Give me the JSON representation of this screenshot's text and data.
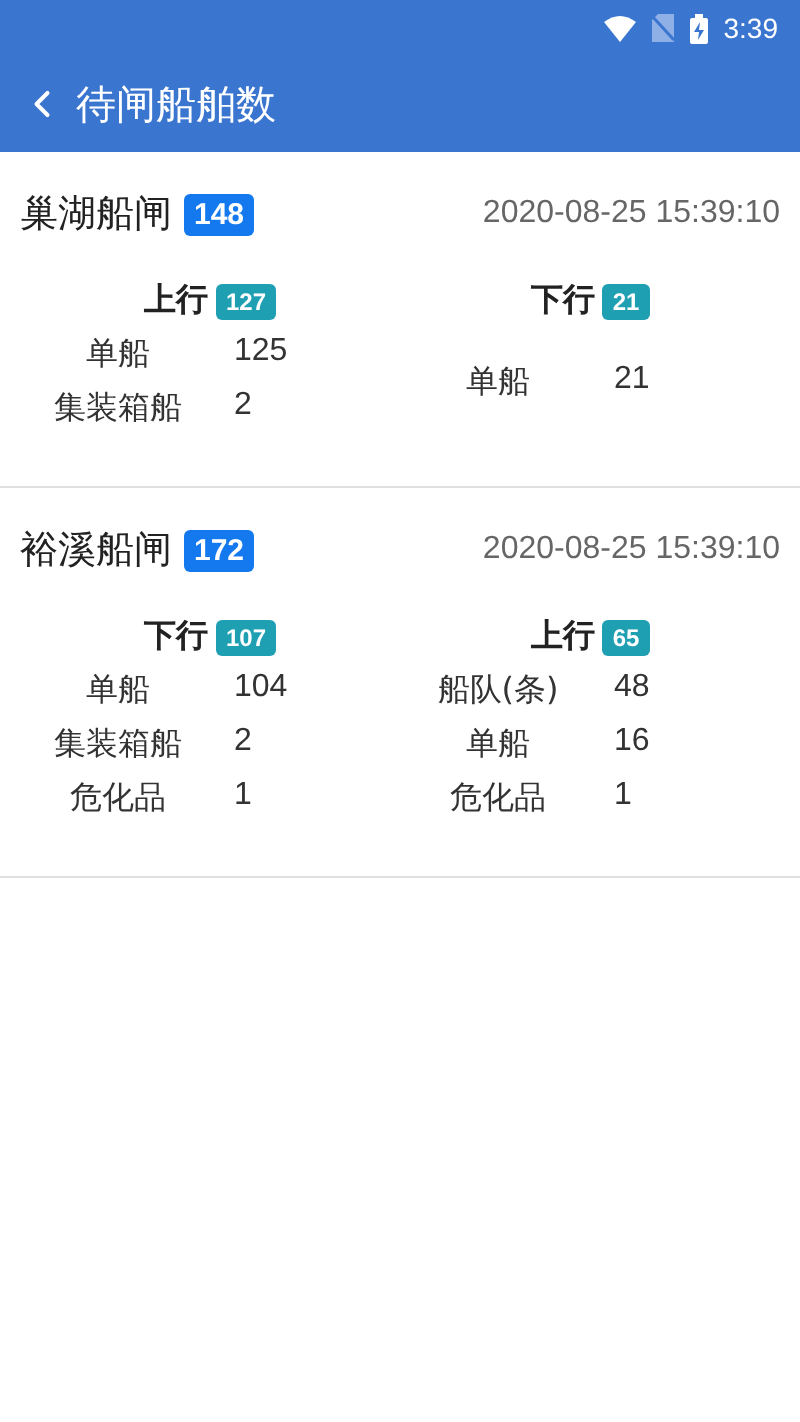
{
  "status_bar": {
    "time": "3:39"
  },
  "app_bar": {
    "title": "待闸船舶数"
  },
  "locks": [
    {
      "name": "巢湖船闸",
      "total": "148",
      "time": "2020-08-25 15:39:10",
      "directions": [
        {
          "label": "上行",
          "count": "127",
          "rows": [
            {
              "type": "单船",
              "count": "125"
            },
            {
              "type": "集装箱船",
              "count": "2"
            }
          ]
        },
        {
          "label": "下行",
          "count": "21",
          "rows": [
            {
              "type": "单船",
              "count": "21"
            }
          ]
        }
      ]
    },
    {
      "name": "裕溪船闸",
      "total": "172",
      "time": "2020-08-25 15:39:10",
      "directions": [
        {
          "label": "下行",
          "count": "107",
          "rows": [
            {
              "type": "单船",
              "count": "104"
            },
            {
              "type": "集装箱船",
              "count": "2"
            },
            {
              "type": "危化品",
              "count": "1"
            }
          ]
        },
        {
          "label": "上行",
          "count": "65",
          "rows": [
            {
              "type": "船队(条)",
              "count": "48"
            },
            {
              "type": "单船",
              "count": "16"
            },
            {
              "type": "危化品",
              "count": "1"
            }
          ]
        }
      ]
    }
  ]
}
